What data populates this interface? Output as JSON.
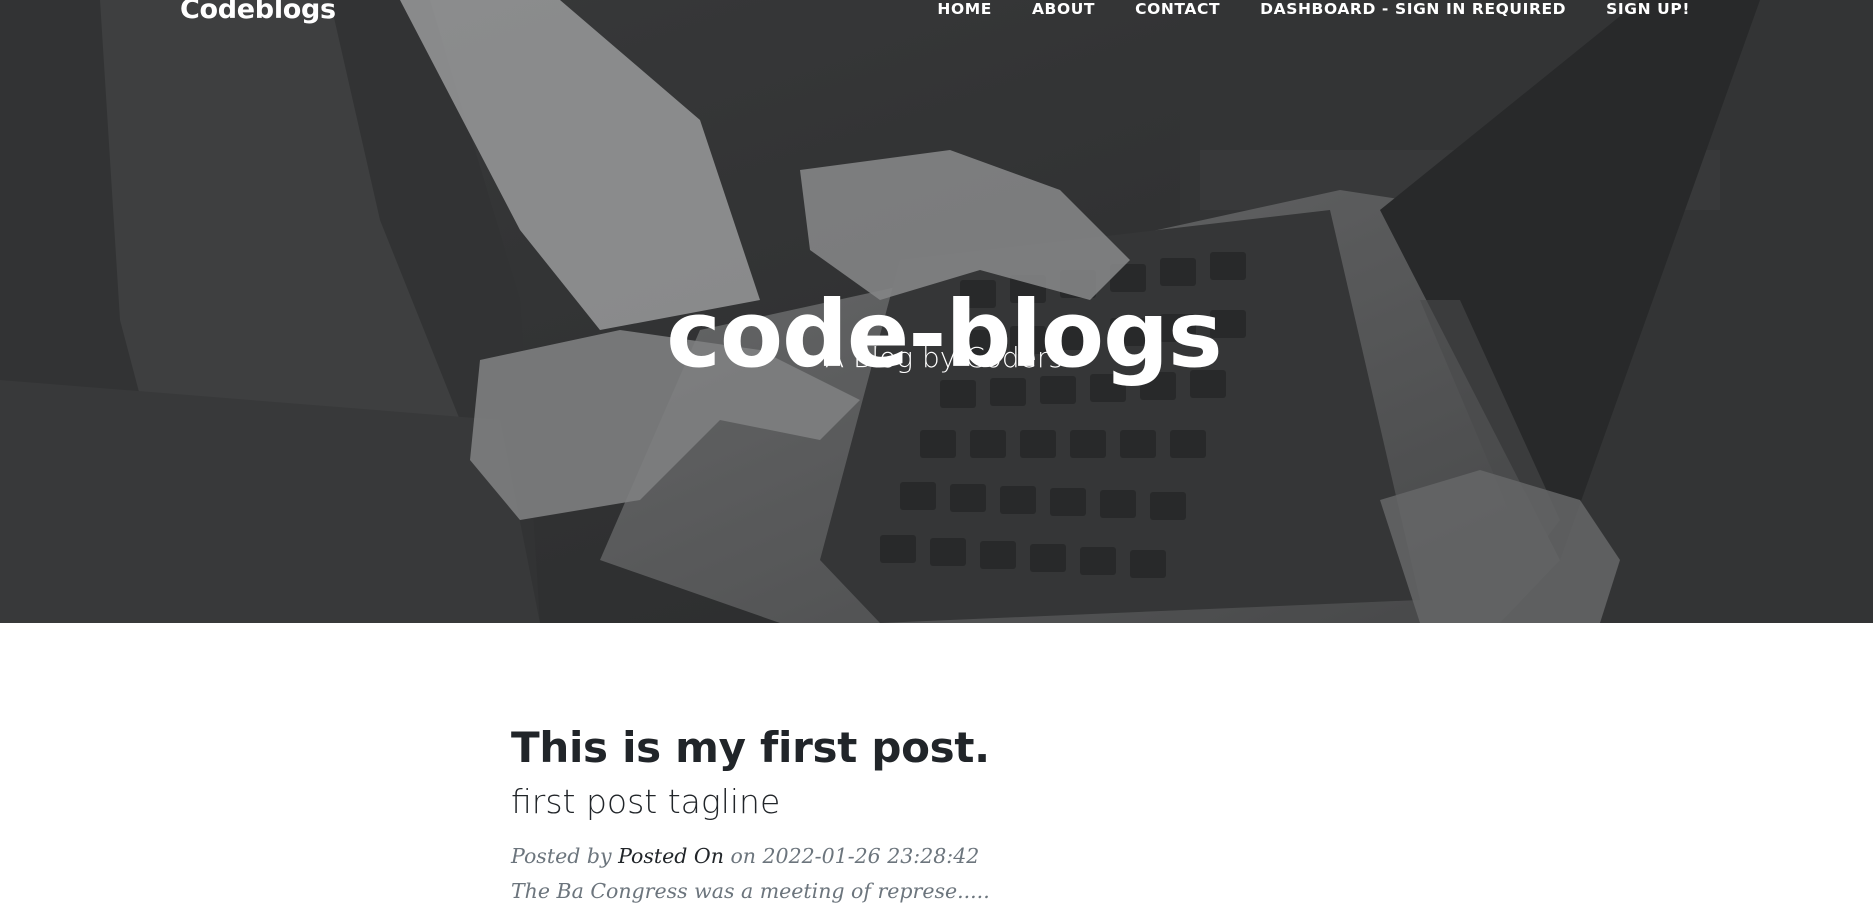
{
  "navbar": {
    "brand": "Codeblogs",
    "links": [
      {
        "label": "HOME"
      },
      {
        "label": "ABOUT"
      },
      {
        "label": "CONTACT"
      },
      {
        "label": "DASHBOARD - SIGN IN REQUIRED"
      },
      {
        "label": "SIGN UP!"
      }
    ]
  },
  "hero": {
    "title": "code-blogs",
    "subtitle": "A Blog by Coders"
  },
  "posts": [
    {
      "title": "This is my first post.",
      "subtitle": "first post tagline",
      "meta_prefix": "Posted by",
      "author": "Posted On",
      "meta_date": "on 2022-01-26 23:28:42",
      "excerpt": "The Ba Congress was a meeting of represe....."
    }
  ],
  "colors": {
    "heading": "#212529",
    "muted": "#6c757d",
    "hero_overlay": "#3a3a3a"
  }
}
